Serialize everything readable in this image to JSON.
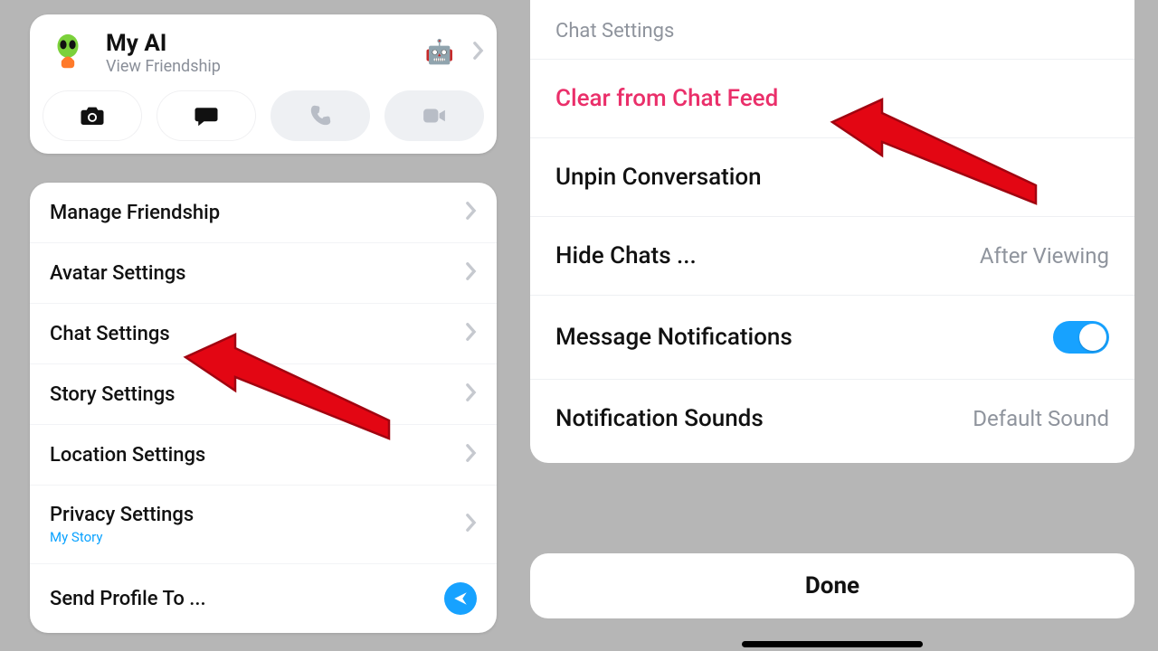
{
  "left": {
    "profile": {
      "name": "My AI",
      "subtitle": "View Friendship",
      "badge_emoji": "🤖"
    },
    "actions": {
      "camera": "camera",
      "chat": "chat",
      "call": "call",
      "video": "video"
    },
    "menu": {
      "manage_friendship": "Manage Friendship",
      "avatar_settings": "Avatar Settings",
      "chat_settings": "Chat Settings",
      "story_settings": "Story Settings",
      "location_settings": "Location Settings",
      "privacy_settings": "Privacy Settings",
      "privacy_sub": "My Story",
      "send_profile": "Send Profile To ..."
    }
  },
  "right": {
    "header": "Chat Settings",
    "rows": {
      "clear": "Clear from Chat Feed",
      "unpin": "Unpin Conversation",
      "hide_label": "Hide Chats ...",
      "hide_value": "After Viewing",
      "msg_notif": "Message Notifications",
      "notif_sounds_label": "Notification Sounds",
      "notif_sounds_value": "Default Sound"
    },
    "done": "Done"
  },
  "colors": {
    "accent_blue": "#17a2ff",
    "danger": "#ea2f6a",
    "arrow_red": "#e30613"
  }
}
